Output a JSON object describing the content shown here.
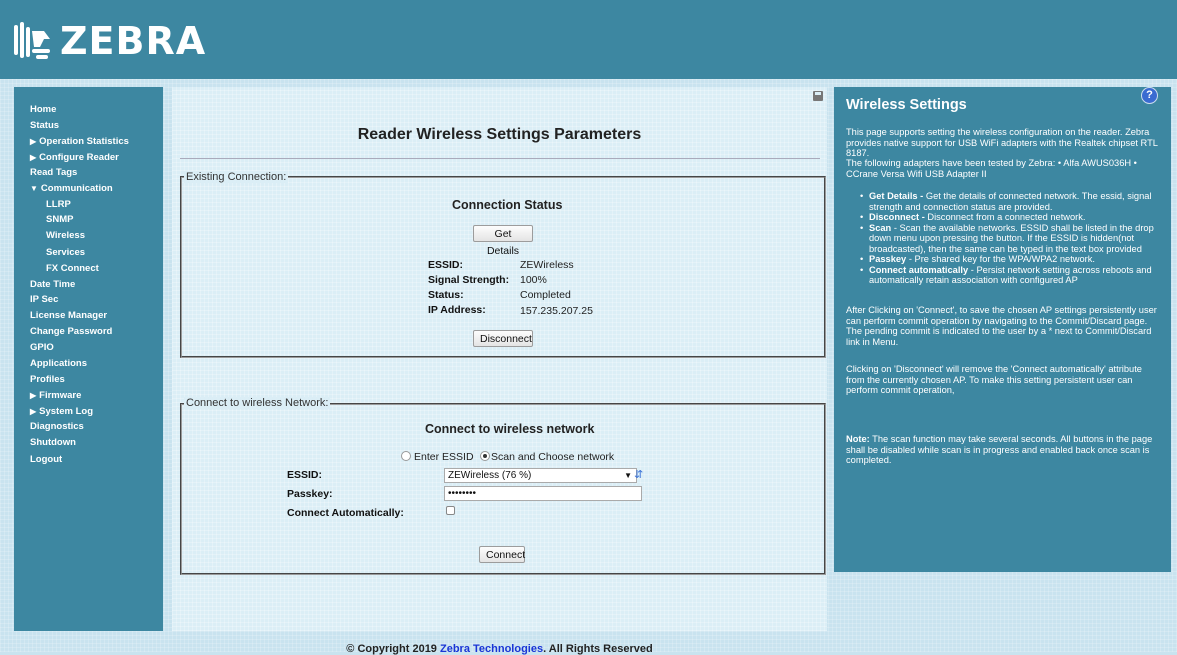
{
  "brand": {
    "logo_text": "ZEBRA"
  },
  "sidebar": {
    "items": [
      {
        "label": "Home"
      },
      {
        "label": "Status"
      },
      {
        "label": "Operation Statistics",
        "caret": "▶"
      },
      {
        "label": "Configure Reader",
        "caret": "▶"
      },
      {
        "label": "Read Tags"
      },
      {
        "label": "Communication",
        "caret": "▼"
      },
      {
        "label": "LLRP"
      },
      {
        "label": "SNMP"
      },
      {
        "label": "Wireless"
      },
      {
        "label": "Services"
      },
      {
        "label": "FX Connect"
      },
      {
        "label": "Date Time"
      },
      {
        "label": "IP Sec"
      },
      {
        "label": "License Manager"
      },
      {
        "label": "Change Password"
      },
      {
        "label": "GPIO"
      },
      {
        "label": "Applications"
      },
      {
        "label": "Profiles"
      },
      {
        "label": "Firmware",
        "caret": "▶"
      },
      {
        "label": "System Log",
        "caret": "▶"
      },
      {
        "label": "Diagnostics"
      },
      {
        "label": "Shutdown"
      },
      {
        "label": "Logout"
      }
    ]
  },
  "main": {
    "title": "Reader Wireless Settings Parameters",
    "existing": {
      "legend": "Existing Connection:",
      "heading": "Connection Status",
      "get_details_label": "Get Details",
      "rows": [
        {
          "label": "ESSID:",
          "value": "ZEWireless"
        },
        {
          "label": "Signal Strength:",
          "value": "100%"
        },
        {
          "label": "Status:",
          "value": "Completed"
        },
        {
          "label": "IP Address:",
          "value": "157.235.207.25"
        }
      ],
      "disconnect_label": "Disconnect"
    },
    "connect": {
      "legend": "Connect to wireless Network:",
      "heading": "Connect to wireless network",
      "radio_enter": "Enter ESSID",
      "radio_scan": "Scan and Choose network",
      "essid_label": "ESSID:",
      "essid_selected": "ZEWireless (76 %)",
      "passkey_label": "Passkey:",
      "passkey_value": "••••••••",
      "auto_label": "Connect Automatically:",
      "connect_label": "Connect"
    }
  },
  "help": {
    "title": "Wireless Settings",
    "icon": "?",
    "intro": "This page supports setting the wireless configuration on the reader. Zebra provides native support for USB WiFi adapters with the Realtek chipset RTL 8187.",
    "tested": "The following adapters have been tested by Zebra: • Alfa AWUS036H • CCrane Versa Wifi USB Adapter II",
    "bullets": [
      {
        "term": "Get Details -",
        "text": " Get the details of connected network. The essid, signal strength and connection status are provided."
      },
      {
        "term": "Disconnect -",
        "text": " Disconnect from a connected network."
      },
      {
        "term": "Scan",
        "text": " - Scan the available networks. ESSID shall be listed in the drop down menu upon pressing the button. If the ESSID is hidden(not broadcasted), then the same can be typed in the text box provided"
      },
      {
        "term": "Passkey",
        "text": " - Pre shared key for the WPA/WPA2 network."
      },
      {
        "term": "Connect automatically",
        "text": " - Persist network setting across reboots and automatically retain association with configured AP"
      }
    ],
    "after_connect": "After Clicking on 'Connect', to save the chosen AP settings persistently user can perform commit operation by navigating to the Commit/Discard page. The pending commit is indicated to the user by a * next to Commit/Discard link in Menu.",
    "after_disconnect": "Clicking on 'Disconnect' will remove the 'Connect automatically' attribute from the currently chosen AP. To make this setting persistent user can perform commit operation,",
    "note_term": "Note:",
    "note_text": " The scan function may take several seconds. All buttons in the page shall be disabled while scan is in progress and enabled back once scan is completed."
  },
  "footer": {
    "prefix": "© Copyright 2019 ",
    "link": "Zebra Technologies",
    "suffix": ". All Rights Reserved"
  },
  "colors": {
    "accent": "#3d87a1",
    "background": "#c9e3ef",
    "link": "#1a35d6"
  }
}
